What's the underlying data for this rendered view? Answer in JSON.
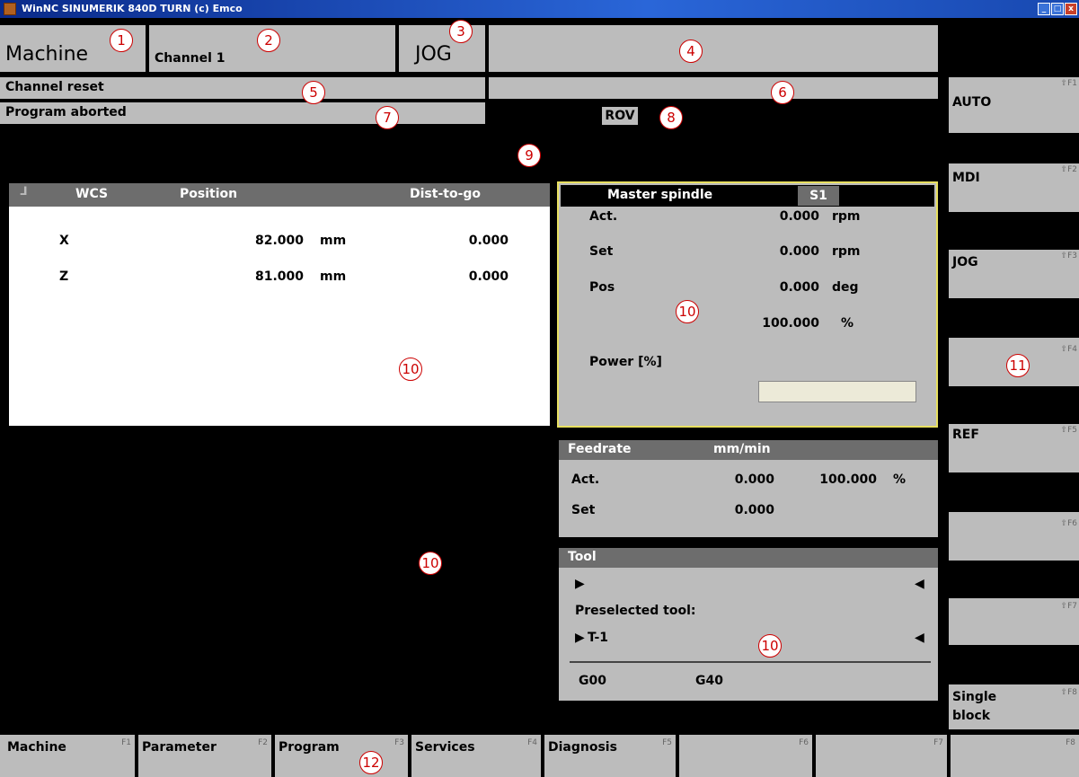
{
  "window": {
    "title": "WinNC SINUMERIK 840D TURN (c) Emco",
    "buttons": [
      "_",
      "□",
      "x"
    ]
  },
  "header": {
    "area": "Machine",
    "channel": "Channel 1",
    "mode": "JOG"
  },
  "status": {
    "channel_state": "Channel reset",
    "program_state": "Program aborted",
    "rov": "ROV"
  },
  "annotations": [
    "1",
    "2",
    "3",
    "4",
    "5",
    "6",
    "7",
    "8",
    "9",
    "10",
    "10",
    "10",
    "10",
    "10",
    "11",
    "12"
  ],
  "axes": {
    "headers": {
      "wcs": "WCS",
      "position": "Position",
      "dist": "Dist-to-go"
    },
    "rows": [
      {
        "axis": "X",
        "position": "82.000",
        "unit": "mm",
        "dist": "0.000"
      },
      {
        "axis": "Z",
        "position": "81.000",
        "unit": "mm",
        "dist": "0.000"
      }
    ]
  },
  "spindle": {
    "title": "Master spindle",
    "id": "S1",
    "rows": [
      {
        "label": "Act.",
        "value": "0.000",
        "unit": "rpm"
      },
      {
        "label": "Set",
        "value": "0.000",
        "unit": "rpm"
      },
      {
        "label": "Pos",
        "value": "0.000",
        "unit": "deg"
      },
      {
        "label": "",
        "value": "100.000",
        "unit": "%"
      }
    ],
    "power_label": "Power [%]",
    "power_fraction": 0
  },
  "feedrate": {
    "title": "Feedrate",
    "unit": "mm/min",
    "act_label": "Act.",
    "act_value": "0.000",
    "act_percent": "100.000",
    "percent_sign": "%",
    "set_label": "Set",
    "set_value": "0.000"
  },
  "tool": {
    "title": "Tool",
    "preselected_label": "Preselected tool:",
    "preselected": "T-1",
    "g1": "G00",
    "g2": "G40"
  },
  "vertical_softkeys": [
    {
      "label": "AUTO",
      "key": "⇧F1"
    },
    {
      "label": "MDI",
      "key": "⇧F2"
    },
    {
      "label": "JOG",
      "key": "⇧F3"
    },
    {
      "label": "",
      "key": "⇧F4"
    },
    {
      "label": "REF",
      "key": "⇧F5"
    },
    {
      "label": "",
      "key": "⇧F6"
    },
    {
      "label": "",
      "key": "⇧F7"
    },
    {
      "label": "Single block",
      "key": "⇧F8"
    }
  ],
  "horizontal_softkeys": [
    {
      "label": "Machine",
      "key": "F1"
    },
    {
      "label": "Parameter",
      "key": "F2"
    },
    {
      "label": "Program",
      "key": "F3"
    },
    {
      "label": "Services",
      "key": "F4"
    },
    {
      "label": "Diagnosis",
      "key": "F5"
    },
    {
      "label": "",
      "key": "F6"
    },
    {
      "label": "",
      "key": "F7"
    },
    {
      "label": "",
      "key": "F8"
    }
  ]
}
